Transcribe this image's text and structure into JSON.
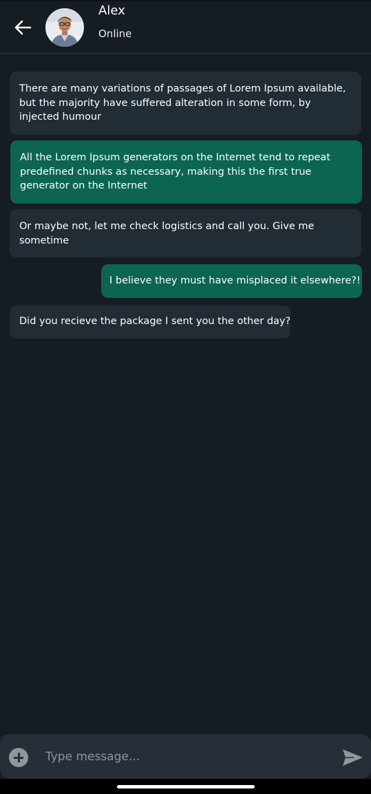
{
  "header": {
    "contact_name": "Alex",
    "status": "Online",
    "back_icon": "arrow-left-icon",
    "avatar_icon": "avatar-photo"
  },
  "messages": [
    {
      "direction": "incoming",
      "text": "There are many variations of passages of Lorem Ipsum available, but the majority have suffered alteration in some form, by injected humour"
    },
    {
      "direction": "outgoing",
      "text": "All the Lorem Ipsum generators on the Internet tend to repeat predefined chunks as necessary, making this the first true generator on the Internet"
    },
    {
      "direction": "incoming",
      "text": "Or maybe not, let me check logistics and call you. Give me sometime"
    },
    {
      "direction": "outgoing",
      "text": "I believe they must have misplaced it elsewhere?!"
    },
    {
      "direction": "incoming",
      "text": "Did you recieve the package I sent you the other day?"
    }
  ],
  "composer": {
    "placeholder": "Type message...",
    "value": "",
    "attach_icon": "plus-circle-icon",
    "send_icon": "send-icon"
  },
  "colors": {
    "background": "#151c22",
    "incoming_bubble": "#212c35",
    "outgoing_bubble": "#0b6551",
    "composer_bg": "#262f37"
  }
}
